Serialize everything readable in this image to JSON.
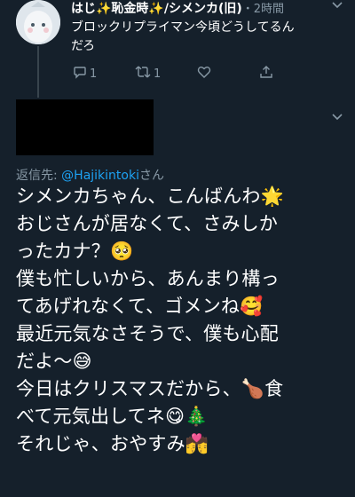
{
  "parent_tweet": {
    "display_name": "はじ✨恥金時✨/シメンカ(旧)",
    "time": "・2時間",
    "text_line1": "ブロックリプライマン今頃どうしてるん",
    "text_line2": "だろ",
    "reply_count": "1",
    "retweet_count": "1"
  },
  "main_tweet": {
    "reply_label": "返信先: ",
    "reply_handle": "@Hajikintoki",
    "reply_suffix": "さん",
    "lines": [
      "シメンカちゃん、こんばんわ🌟",
      "おじさんが居なくて、さみしか",
      "ったカナ？🥺",
      "僕も忙しいから、あんまり構っ",
      "てあげれなくて、ゴメンね🥰",
      "最近元気なさそうで、僕も心配",
      "だよ〜😅",
      "今日はクリスマスだから、🍗食",
      "べて元気出してネ😋🎄",
      "それじゃ、おやすみ💏"
    ]
  },
  "colors": {
    "background": "#15202b",
    "muted": "#8899a6",
    "link": "#1da1f2"
  }
}
